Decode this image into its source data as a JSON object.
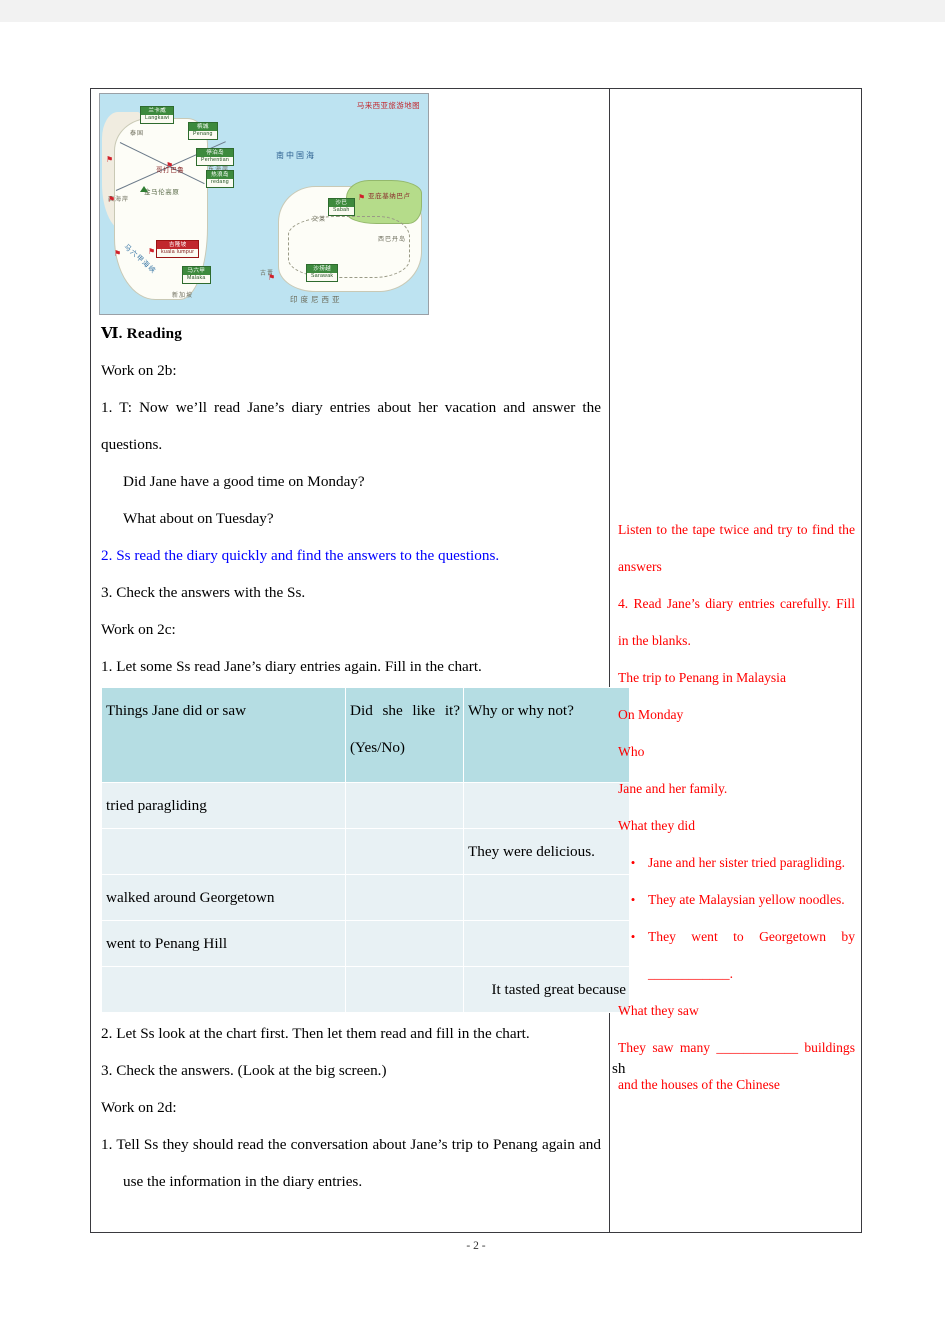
{
  "document": {
    "page_number_label": "- 2 -"
  },
  "map": {
    "title_cn": "马来西亚旅游地图",
    "sea_labels": [
      {
        "text": "南中国海"
      },
      {
        "text": "马六甲海峡"
      }
    ],
    "ocean_side_labels": [
      "泰国",
      "东海岸",
      "西海岸",
      "新加坡",
      "印度尼西亚",
      "文莱",
      "西巴丹岛",
      "古晋"
    ],
    "place_labels": [
      {
        "cn": "兰卡威",
        "en": "Langkawi",
        "style": "green"
      },
      {
        "cn": "槟城",
        "en": "Penang",
        "style": "green"
      },
      {
        "cn": "停泊岛",
        "en": "Perhentian",
        "style": "green"
      },
      {
        "cn": "热浪岛",
        "en": "redang",
        "style": "green"
      },
      {
        "cn": "沙巴",
        "en": "Sabah",
        "style": "green"
      },
      {
        "cn": "吉隆坡",
        "en": "kuala lumpur",
        "style": "red"
      },
      {
        "cn": "马六甲",
        "en": "Malaka",
        "style": "green"
      },
      {
        "cn": "沙捞越",
        "en": "Sarawak",
        "style": "green"
      }
    ],
    "cities": [
      "哥打巴鲁",
      "金马伦高原",
      "亚庇基纳巴卢"
    ]
  },
  "left_column": {
    "section_heading": "Ⅵ. Reading",
    "blocks": [
      {
        "id": "work2b",
        "text": "Work on 2b:"
      },
      {
        "id": "t1",
        "text": "1. T: Now we’ll read Jane’s diary entries about her vacation and answer the questions."
      },
      {
        "id": "q1",
        "text": "Did Jane have a good time on Monday?"
      },
      {
        "id": "q2",
        "text": "What about on Tuesday?"
      },
      {
        "id": "t2",
        "text": "2. Ss read the diary quickly and find the answers to the questions."
      },
      {
        "id": "t3",
        "text": "3. Check the answers with the Ss."
      },
      {
        "id": "work2c",
        "text": "Work on 2c:"
      },
      {
        "id": "c1",
        "text": "1. Let some Ss read Jane’s diary entries again. Fill in the chart."
      }
    ],
    "after_chart_blocks": [
      {
        "id": "c2",
        "text": "2. Let Ss look at the chart first. Then let them read and fill in the chart."
      },
      {
        "id": "c3",
        "text": "3. Check the answers. (Look at the big screen.)"
      },
      {
        "id": "work2d",
        "text": "Work on 2d:"
      },
      {
        "id": "d1",
        "text": "1. Tell Ss they should read the conversation about Jane’s trip to Penang again and use the information in the diary entries."
      }
    ],
    "overflow_fragment": "sh"
  },
  "chart_table": {
    "headers": [
      "Things Jane did or saw",
      "Did she like it? (Yes/No)",
      "Why or why not?"
    ],
    "rows": [
      {
        "thing": "tried paragliding",
        "like": "",
        "why": ""
      },
      {
        "thing": "",
        "like": "",
        "why": "They were delicious."
      },
      {
        "thing": "walked around Georgetown",
        "like": "",
        "why": ""
      },
      {
        "thing": "went to Penang Hill",
        "like": "",
        "why": ""
      },
      {
        "thing": "",
        "like": "",
        "why": "It tasted great because"
      }
    ]
  },
  "right_column": {
    "blocks": [
      {
        "type": "p",
        "text": "Listen to the tape twice and try to find the answers"
      },
      {
        "type": "p",
        "text": "4. Read Jane’s diary entries carefully. Fill in the blanks."
      },
      {
        "type": "p",
        "text": "The trip to Penang in Malaysia"
      },
      {
        "type": "p",
        "text": "On Monday"
      },
      {
        "type": "p",
        "text": "Who"
      },
      {
        "type": "p",
        "text": "Jane and her family."
      },
      {
        "type": "p",
        "text": "What they did"
      },
      {
        "type": "bullet",
        "text": "Jane and her sister tried paragliding."
      },
      {
        "type": "bullet",
        "text": "They ate Malaysian yellow noodles."
      },
      {
        "type": "bullet",
        "text": "They went to Georgetown by ____________."
      },
      {
        "type": "p",
        "text": "What they saw"
      },
      {
        "type": "p",
        "text": "They saw many ____________ buildings and the houses of the Chinese"
      }
    ]
  },
  "colors": {
    "blue_text": "#0000ff",
    "red_text": "#ff0000",
    "chart_header_bg": "#b5dde3",
    "chart_body_bg": "#e8f1f4",
    "frame_border": "#3a3a3f"
  }
}
